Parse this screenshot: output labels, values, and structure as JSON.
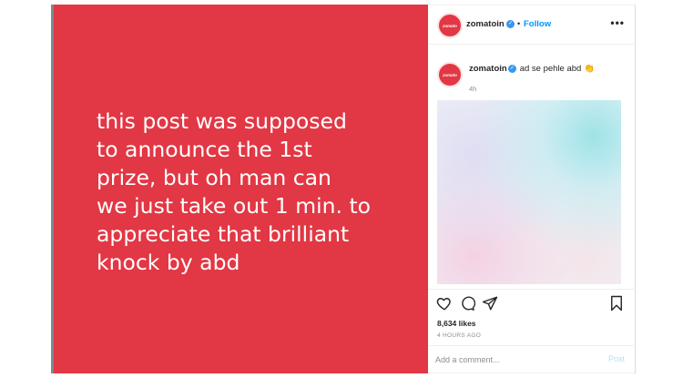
{
  "post": {
    "image_text": "this post was supposed\nto announce the 1st\nprize, but oh man can\nwe just take out 1 min. to\nappreciate that brilliant\nknock by abd",
    "brand_color": "#e23744"
  },
  "header": {
    "avatar_text": "zomato",
    "username": "zomatoin",
    "verified_icon": "verified-badge-icon",
    "separator": "•",
    "follow_label": "Follow",
    "more_icon": "more-options-icon"
  },
  "comment": {
    "avatar_text": "zomato",
    "username": "zomatoin",
    "text": "ad se pehle abd 👏",
    "time": "4h"
  },
  "actions": {
    "like_icon": "heart-icon",
    "comment_icon": "comment-icon",
    "share_icon": "share-icon",
    "save_icon": "bookmark-icon"
  },
  "likes": "8,634 likes",
  "timestamp": "4 HOURS AGO",
  "add_comment": {
    "placeholder": "Add a comment...",
    "post_label": "Post"
  }
}
